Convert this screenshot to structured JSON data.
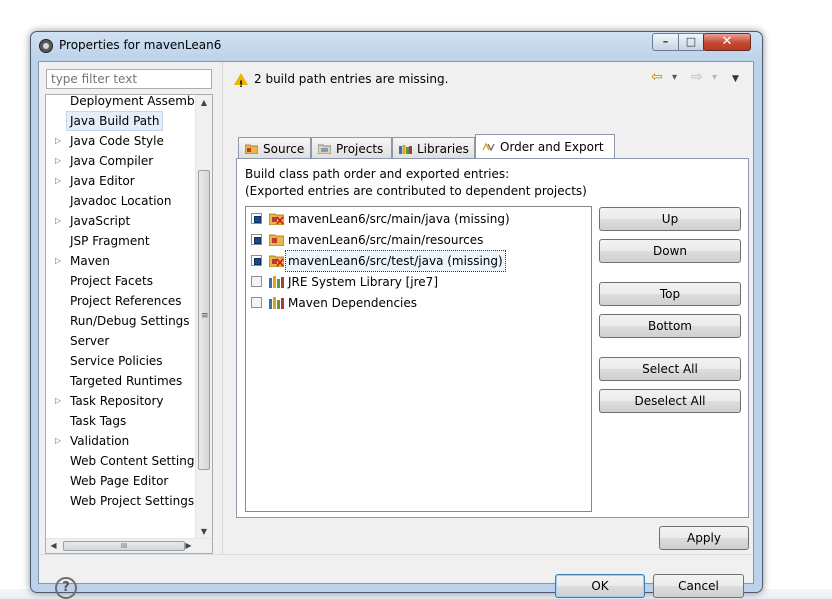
{
  "window": {
    "title": "Properties for mavenLean6",
    "minimize_glyph": "–",
    "maximize_glyph": "□",
    "close_glyph": "✕"
  },
  "filter": {
    "placeholder": "type filter text"
  },
  "tree": {
    "items": [
      {
        "label": "Deployment Assembly",
        "expandable": false,
        "selected": false
      },
      {
        "label": "Java Build Path",
        "expandable": false,
        "selected": true
      },
      {
        "label": "Java Code Style",
        "expandable": true,
        "selected": false
      },
      {
        "label": "Java Compiler",
        "expandable": true,
        "selected": false
      },
      {
        "label": "Java Editor",
        "expandable": true,
        "selected": false
      },
      {
        "label": "Javadoc Location",
        "expandable": false,
        "selected": false
      },
      {
        "label": "JavaScript",
        "expandable": true,
        "selected": false
      },
      {
        "label": "JSP Fragment",
        "expandable": false,
        "selected": false
      },
      {
        "label": "Maven",
        "expandable": true,
        "selected": false
      },
      {
        "label": "Project Facets",
        "expandable": false,
        "selected": false
      },
      {
        "label": "Project References",
        "expandable": false,
        "selected": false
      },
      {
        "label": "Run/Debug Settings",
        "expandable": false,
        "selected": false
      },
      {
        "label": "Server",
        "expandable": false,
        "selected": false
      },
      {
        "label": "Service Policies",
        "expandable": false,
        "selected": false
      },
      {
        "label": "Targeted Runtimes",
        "expandable": false,
        "selected": false
      },
      {
        "label": "Task Repository",
        "expandable": true,
        "selected": false
      },
      {
        "label": "Task Tags",
        "expandable": false,
        "selected": false
      },
      {
        "label": "Validation",
        "expandable": true,
        "selected": false
      },
      {
        "label": "Web Content Settings",
        "expandable": false,
        "selected": false
      },
      {
        "label": "Web Page Editor",
        "expandable": false,
        "selected": false
      },
      {
        "label": "Web Project Settings",
        "expandable": false,
        "selected": false
      }
    ]
  },
  "message": "2 build path entries are missing.",
  "nav": {
    "back_glyph": "⇦",
    "forward_glyph": "⇨",
    "dropdown_glyph": "▾",
    "menu_glyph": "▼"
  },
  "tabs": [
    {
      "label": "Source",
      "active": false
    },
    {
      "label": "Projects",
      "active": false
    },
    {
      "label": "Libraries",
      "active": false
    },
    {
      "label": "Order and Export",
      "active": true
    }
  ],
  "order_export": {
    "description_line1": "Build class path order and exported entries:",
    "description_line2": "(Exported entries are contributed to dependent projects)",
    "entries": [
      {
        "label": "mavenLean6/src/main/java (missing)",
        "checked": true,
        "icon": "missing-source-folder-icon"
      },
      {
        "label": "mavenLean6/src/main/resources",
        "checked": true,
        "icon": "source-folder-icon"
      },
      {
        "label": "mavenLean6/src/test/java (missing)",
        "checked": true,
        "icon": "missing-source-folder-icon"
      },
      {
        "label": "JRE System Library [jre7]",
        "checked": false,
        "icon": "library-icon"
      },
      {
        "label": "Maven Dependencies",
        "checked": false,
        "icon": "library-icon"
      }
    ],
    "buttons": {
      "up": "Up",
      "down": "Down",
      "top": "Top",
      "bottom": "Bottom",
      "select_all": "Select All",
      "deselect_all": "Deselect All"
    }
  },
  "footer": {
    "apply": "Apply",
    "ok": "OK",
    "cancel": "Cancel",
    "help_glyph": "?"
  },
  "scroll": {
    "thumb_grip": "≡",
    "hthumb_grip": "III",
    "up": "▲",
    "down": "▼",
    "left": "◀",
    "right": "▶"
  },
  "colors": {
    "window_frame": "#bcd2ea",
    "warning": "#f0b400",
    "selection": "#e5eef8",
    "checkbox_fill": "#1a4a8a"
  }
}
